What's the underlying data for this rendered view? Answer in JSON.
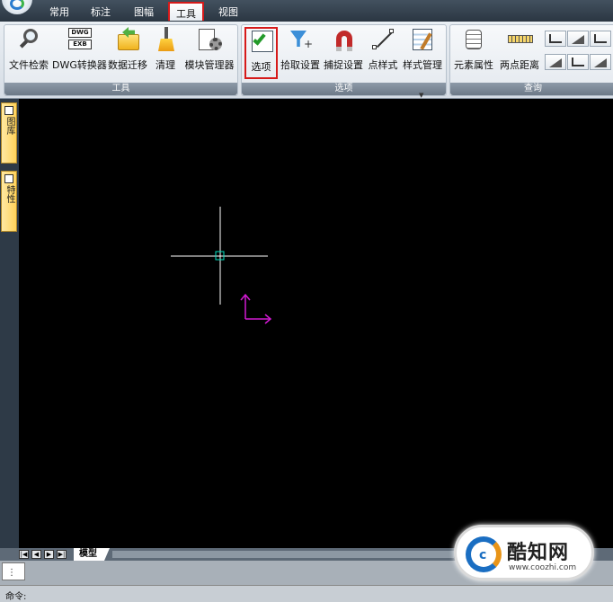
{
  "tabs": {
    "common": "常用",
    "annotate": "标注",
    "sheet": "图幅",
    "tools": "工具",
    "view": "视图"
  },
  "ribbon": {
    "tools_group": {
      "label": "工具",
      "file_search": "文件检索",
      "dwg_converter": "DWG转换器",
      "data_migrate": "数据迁移",
      "clean": "清理",
      "module_manager": "模块管理器"
    },
    "options_group": {
      "label": "选项",
      "options": "选项",
      "pick_settings": "拾取设置",
      "snap_settings": "捕捉设置",
      "point_style": "点样式",
      "style_manager": "样式管理"
    },
    "query_group": {
      "label": "查询",
      "element_props": "元素属性",
      "two_point_distance": "两点距离"
    },
    "dwg_icon_top": "DWG",
    "dwg_icon_bottom": "EXB"
  },
  "dock": {
    "library": "图库",
    "properties": "特性"
  },
  "layout": {
    "model_tab": "模型",
    "nav_first": "|◀",
    "nav_prev": "◀",
    "nav_next": "▶",
    "nav_last": "▶|"
  },
  "command": {
    "prompt": "命令:",
    "grip": "⋮"
  },
  "watermark": {
    "logo_letter": "c",
    "title": "酷知网",
    "url": "www.coozhi.com"
  },
  "colors": {
    "crosshair": "#ffffff",
    "pick_box": "#00e0c0",
    "ucs": "#d21ad2",
    "highlight": "#d61a1a"
  },
  "icons": {
    "tools_tab": "tab-tools",
    "options": "check-icon"
  }
}
